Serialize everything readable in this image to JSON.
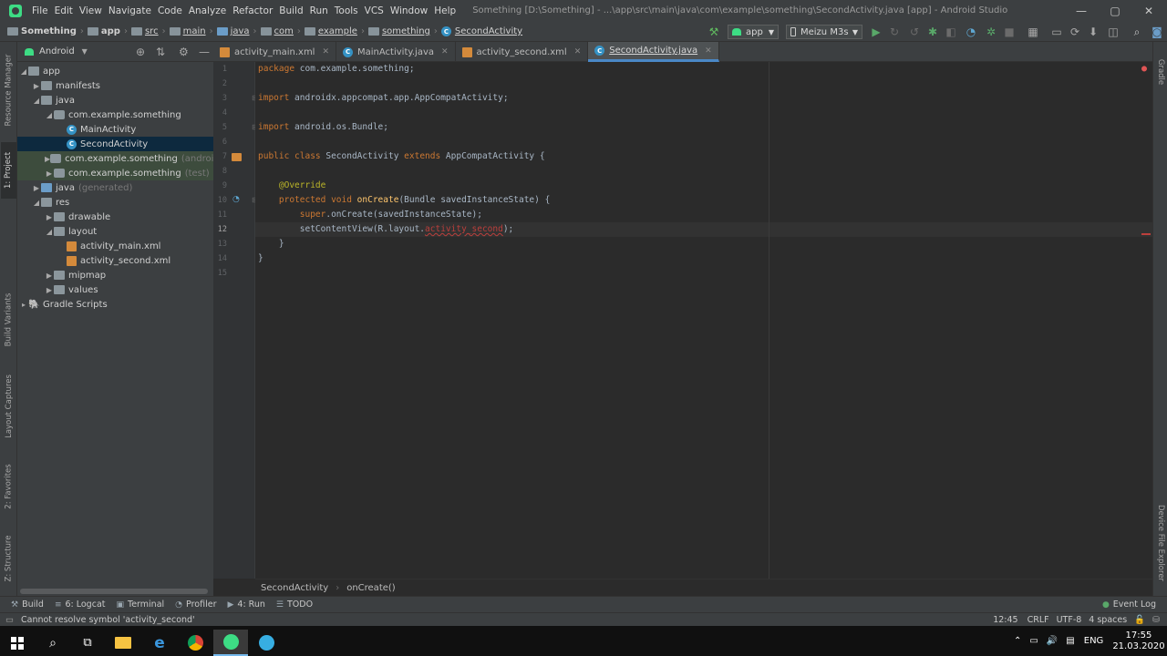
{
  "window": {
    "title": "Something [D:\\Something] - ...\\app\\src\\main\\java\\com\\example\\something\\SecondActivity.java [app] - Android Studio",
    "controls": {
      "minimize": "—",
      "maximize": "▢",
      "close": "✕"
    }
  },
  "menu": [
    "File",
    "Edit",
    "View",
    "Navigate",
    "Code",
    "Analyze",
    "Refactor",
    "Build",
    "Run",
    "Tools",
    "VCS",
    "Window",
    "Help"
  ],
  "breadcrumb": [
    "Something",
    "app",
    "src",
    "main",
    "java",
    "com",
    "example",
    "something",
    "SecondActivity"
  ],
  "toolbar": {
    "run_config": "app",
    "device": "Meizu M3s"
  },
  "left_strip": {
    "tabs": [
      "Resource Manager",
      "1: Project",
      "Build Variants",
      "Layout Captures",
      "2: Favorites",
      "Z: Structure"
    ]
  },
  "right_strip": {
    "tabs": [
      "Gradle",
      "Device File Explorer"
    ]
  },
  "project": {
    "view_mode": "Android",
    "tree": [
      {
        "label": "app",
        "suffix": ""
      },
      {
        "label": "manifests",
        "suffix": ""
      },
      {
        "label": "java",
        "suffix": ""
      },
      {
        "label": "com.example.something",
        "suffix": ""
      },
      {
        "label": "MainActivity",
        "suffix": ""
      },
      {
        "label": "SecondActivity",
        "suffix": ""
      },
      {
        "label": "com.example.something",
        "suffix": "(androidTest)"
      },
      {
        "label": "com.example.something",
        "suffix": "(test)"
      },
      {
        "label": "java",
        "suffix": "(generated)"
      },
      {
        "label": "res",
        "suffix": ""
      },
      {
        "label": "drawable",
        "suffix": ""
      },
      {
        "label": "layout",
        "suffix": ""
      },
      {
        "label": "activity_main.xml",
        "suffix": ""
      },
      {
        "label": "activity_second.xml",
        "suffix": ""
      },
      {
        "label": "mipmap",
        "suffix": ""
      },
      {
        "label": "values",
        "suffix": ""
      },
      {
        "label": "Gradle Scripts",
        "suffix": ""
      }
    ]
  },
  "tabs": [
    {
      "label": "activity_main.xml"
    },
    {
      "label": "MainActivity.java"
    },
    {
      "label": "activity_second.xml"
    },
    {
      "label": "SecondActivity.java"
    }
  ],
  "editor": {
    "line_numbers": [
      "1",
      "2",
      "3",
      "4",
      "5",
      "6",
      "7",
      "8",
      "9",
      "10",
      "11",
      "12",
      "13",
      "14",
      "15"
    ],
    "current_line": "12",
    "code": {
      "l1_kw": "package",
      "l1_rest": " com.example.something;",
      "l3_kw": "import",
      "l3_rest": " androidx.appcompat.app.AppCompatActivity;",
      "l5_kw": "import",
      "l5_rest": " android.os.Bundle;",
      "l7_kw1": "public class",
      "l7_name": " SecondActivity ",
      "l7_kw2": "extends",
      "l7_rest": " AppCompatActivity {",
      "l9_ann": "    @Override",
      "l10_kw": "    protected void",
      "l10_fn": " onCreate",
      "l10_rest": "(Bundle savedInstanceState) {",
      "l11_kw": "        super",
      "l11_rest": ".onCreate(savedInstanceState);",
      "l12_pre": "        setContentView(R.layout.",
      "l12_err": "activity_second",
      "l12_post": ");",
      "l13": "    }",
      "l14": "}"
    }
  },
  "editor_breadcrumb": [
    "SecondActivity",
    "onCreate()"
  ],
  "bottom_tools": [
    {
      "icon": "hammer-icon",
      "label": "Build"
    },
    {
      "icon": "logcat-icon",
      "label": "6: Logcat"
    },
    {
      "icon": "terminal-icon",
      "label": "Terminal"
    },
    {
      "icon": "profiler-icon",
      "label": "Profiler"
    },
    {
      "icon": "run-icon",
      "label": "4: Run"
    },
    {
      "icon": "todo-icon",
      "label": "TODO"
    }
  ],
  "event_log": "Event Log",
  "status": {
    "message": "Cannot resolve symbol 'activity_second'",
    "position": "12:45",
    "line_sep": "CRLF",
    "encoding": "UTF-8",
    "indent": "4 spaces"
  },
  "taskbar": {
    "language": "ENG",
    "time": "17:55",
    "date": "21.03.2020"
  },
  "colors": {
    "keyword": "#cc7832",
    "annotation": "#bbb529",
    "method": "#ffc66d",
    "error": "#bc3f3c",
    "accent": "#4a88c7"
  }
}
